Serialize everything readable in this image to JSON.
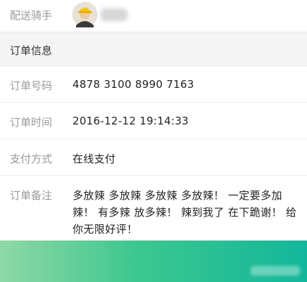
{
  "rider": {
    "label": "配送骑手",
    "avatar_icon": "rider-avatar-icon"
  },
  "order_info": {
    "title": "订单信息",
    "order_no": {
      "label": "订单号码",
      "value": "4878 3100 8990 7163"
    },
    "order_time": {
      "label": "订单时间",
      "value": "2016-12-12 19:14:33"
    },
    "payment": {
      "label": "支付方式",
      "value": "在线支付"
    },
    "note": {
      "label": "订单备注",
      "value": "多放辣 多放辣 多放辣 多放辣！ 一定要多加辣！ 有多辣 放多辣！ 辣到我了 在下跪谢！ 给你无限好评！"
    }
  },
  "colors": {
    "label_gray": "#999999",
    "section_bg": "#f4f4f4",
    "bottom_bar_green": "#12b79b"
  }
}
